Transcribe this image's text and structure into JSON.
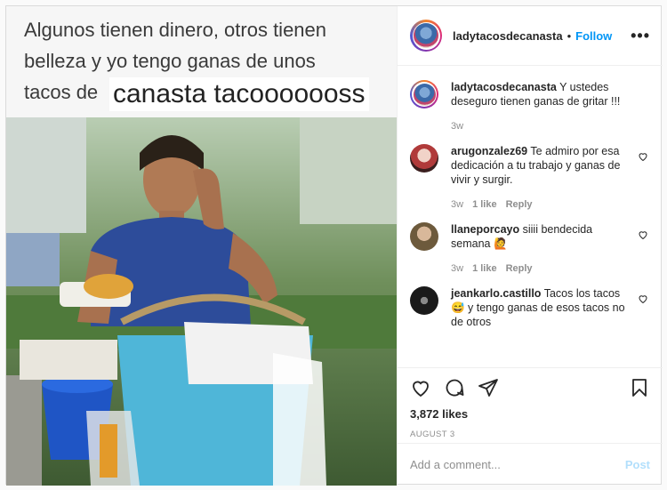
{
  "meme": {
    "line1": "Algunos tienen dinero, otros tienen",
    "line2": "belleza y yo tengo ganas de unos",
    "line3": "tacos de",
    "overlay": "canasta tacooooooss"
  },
  "header": {
    "username": "ladytacosdecanasta",
    "dot": "•",
    "follow": "Follow",
    "more": "•••"
  },
  "caption": {
    "username": "ladytacosdecanasta",
    "text": "Y ustedes deseguro tienen ganas de gritar !!!",
    "time": "3w"
  },
  "comments": [
    {
      "username": "arugonzalez69",
      "text": "Te admiro por esa dedicación a tu trabajo y ganas de vivir y surgir.",
      "time": "3w",
      "likes": "1 like",
      "reply": "Reply",
      "avatar_color": "#b03a3a"
    },
    {
      "username": "llaneporcayo",
      "text": "siiii bendecida semana 🙋",
      "time": "3w",
      "likes": "1 like",
      "reply": "Reply",
      "avatar_color": "#6d5a3c"
    },
    {
      "username": "jeankarlo.castillo",
      "text": "Tacos los tacos 😅 y tengo ganas de esos tacos no de otros",
      "time": "",
      "likes": "",
      "reply": "",
      "avatar_color": "#1a1a1a"
    }
  ],
  "icons": {
    "like": "heart-icon",
    "comment": "comment-icon",
    "share": "share-icon",
    "save": "bookmark-icon"
  },
  "likes": "3,872 likes",
  "date": "AUGUST 3",
  "add_comment": {
    "placeholder": "Add a comment...",
    "post": "Post"
  },
  "colors": {
    "link": "#0095f6",
    "muted": "#8e8e8e",
    "post_disabled": "#b2dffc"
  }
}
